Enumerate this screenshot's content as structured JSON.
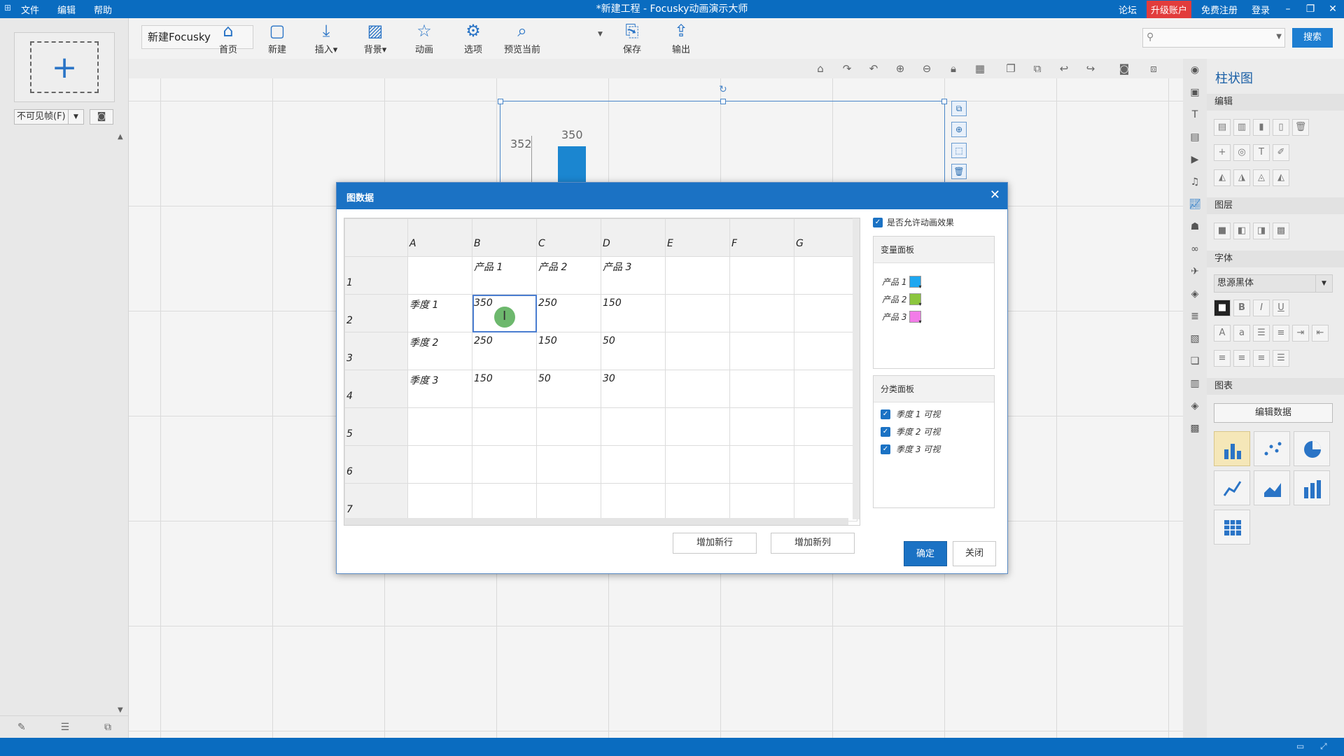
{
  "app": {
    "title": "*新建工程 - Focusky动画演示大师",
    "menu": [
      "文件",
      "编辑",
      "帮助"
    ],
    "right_links": {
      "forum": "论坛",
      "upgrade": "升级账户",
      "register": "免费注册",
      "login": "登录"
    }
  },
  "toolbar": {
    "project_name": "新建Focusky",
    "buttons": [
      {
        "label": "首页",
        "icon": "home-icon"
      },
      {
        "label": "新建",
        "icon": "new-frame-icon"
      },
      {
        "label": "插入",
        "icon": "insert-icon"
      },
      {
        "label": "背景",
        "icon": "background-icon"
      },
      {
        "label": "动画",
        "icon": "animation-star-icon"
      },
      {
        "label": "选项",
        "icon": "gear-icon"
      },
      {
        "label": "预览当前",
        "icon": "preview-icon"
      },
      {
        "label": "保存",
        "icon": "save-icon"
      },
      {
        "label": "输出",
        "icon": "export-icon"
      }
    ],
    "search_placeholder": "",
    "search_button": "搜索"
  },
  "left_panel": {
    "frame_select": "不可见帧(F)"
  },
  "canvas": {
    "axis_label": "352",
    "bar_label": "350",
    "bar_color": "#1b86d0"
  },
  "properties": {
    "title": "柱状图",
    "sections": {
      "edit": "编辑",
      "layer": "图层",
      "font": "字体",
      "chart": "图表"
    },
    "font_name": "思源黑体",
    "edit_data_button": "编辑数据"
  },
  "dialog": {
    "title": "图数据",
    "columns": [
      "A",
      "B",
      "C",
      "D",
      "E",
      "F",
      "G"
    ],
    "row_numbers": [
      "1",
      "2",
      "3",
      "4",
      "5",
      "6",
      "7"
    ],
    "rows": [
      [
        "",
        "产品 1",
        "产品 2",
        "产品 3",
        "",
        "",
        ""
      ],
      [
        "季度 1",
        "350",
        "250",
        "150",
        "",
        "",
        ""
      ],
      [
        "季度 2",
        "250",
        "150",
        "50",
        "",
        "",
        ""
      ],
      [
        "季度 3",
        "150",
        "50",
        "30",
        "",
        "",
        ""
      ],
      [
        "",
        "",
        "",
        "",
        "",
        "",
        ""
      ],
      [
        "",
        "",
        "",
        "",
        "",
        "",
        ""
      ],
      [
        "",
        "",
        "",
        "",
        "",
        "",
        ""
      ]
    ],
    "allow_animation": "是否允许动画效果",
    "variable_panel": {
      "title": "变量面板",
      "items": [
        {
          "label": "产品 1",
          "color": "#1ea7f0"
        },
        {
          "label": "产品 2",
          "color": "#8cc63e"
        },
        {
          "label": "产品 3",
          "color": "#f27ce8"
        }
      ]
    },
    "category_panel": {
      "title": "分类面板",
      "items": [
        "季度 1 可视",
        "季度 2 可视",
        "季度 3 可视"
      ]
    },
    "add_row": "增加新行",
    "add_column": "增加新列",
    "ok": "确定",
    "close": "关闭"
  }
}
